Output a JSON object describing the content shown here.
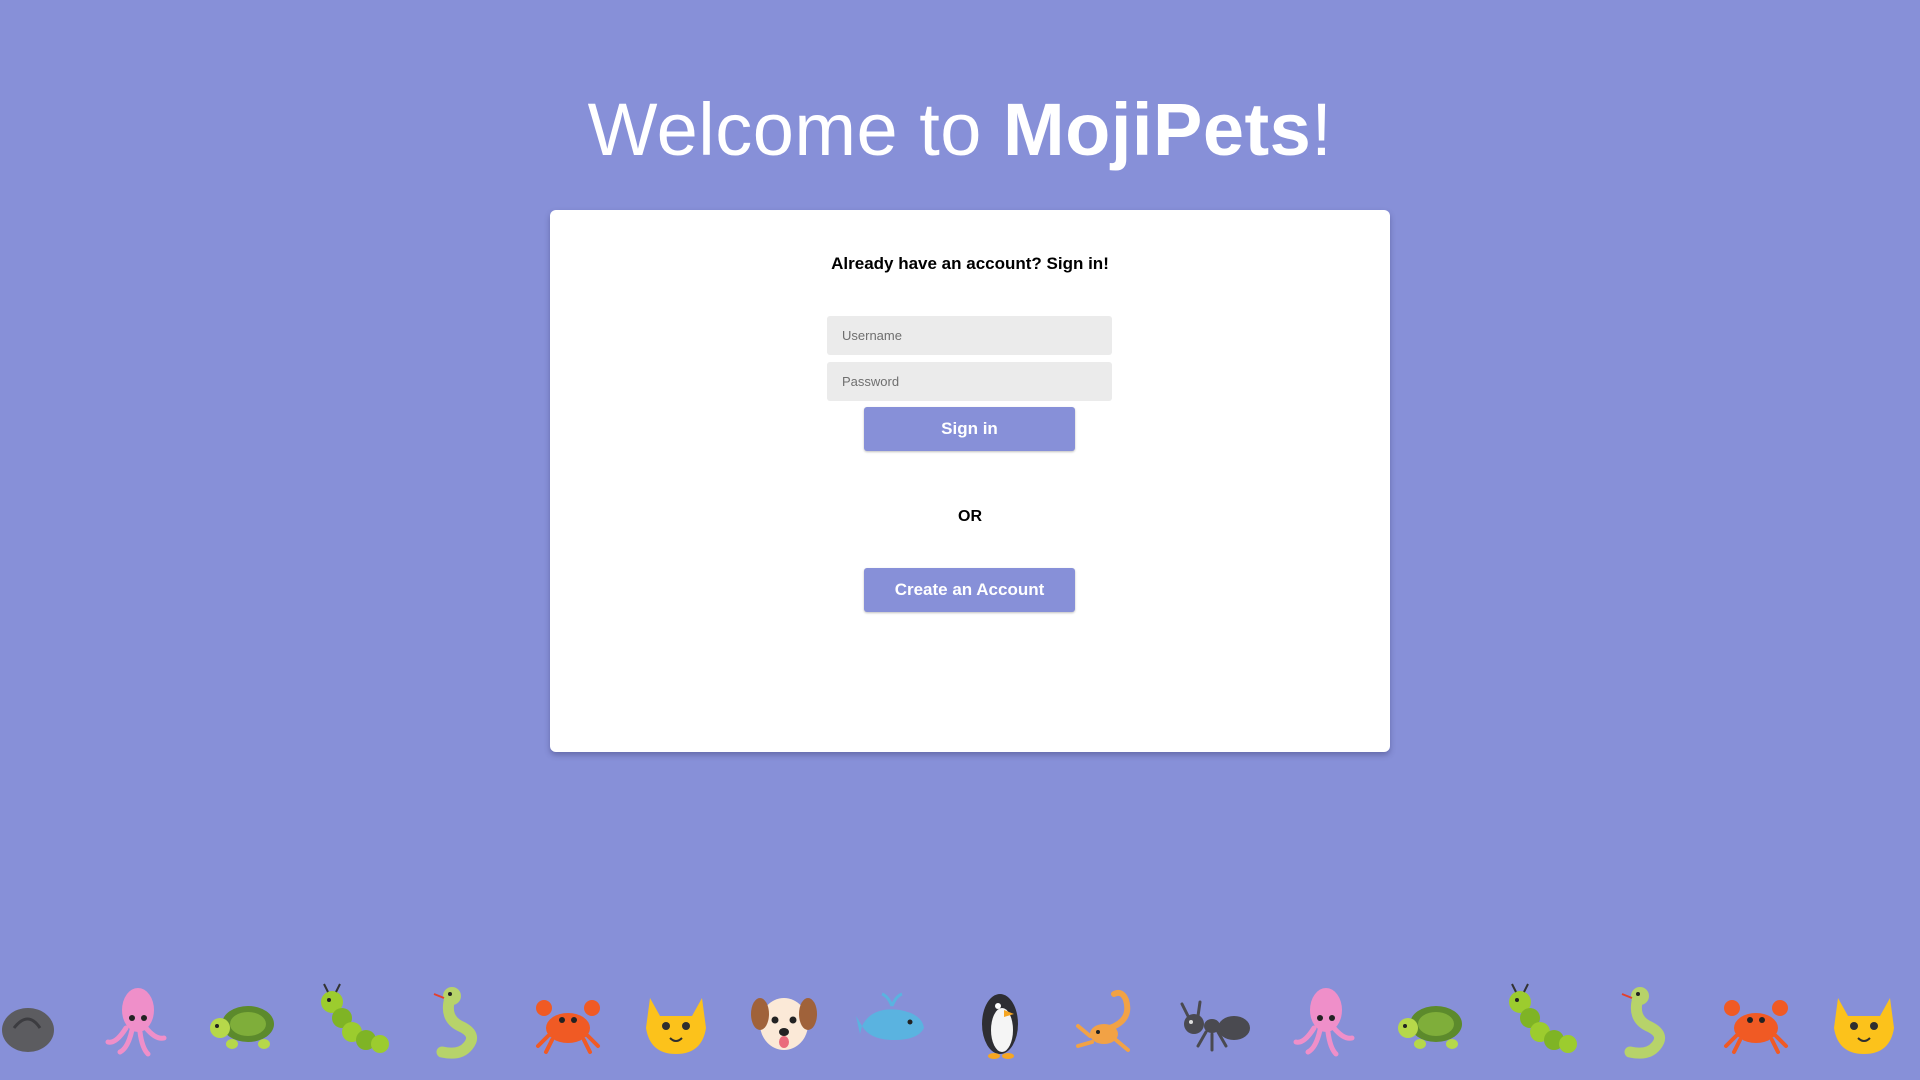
{
  "header": {
    "title_prefix": "Welcome to ",
    "brand": "MojiPets",
    "title_suffix": "!"
  },
  "signin": {
    "heading": "Already have an account? Sign in!",
    "username_placeholder": "Username",
    "username_value": "",
    "password_placeholder": "Password",
    "password_value": "",
    "signin_label": "Sign in"
  },
  "divider": {
    "label": "OR"
  },
  "signup": {
    "create_label": "Create an Account"
  },
  "colors": {
    "background": "#8790d8",
    "card": "#ffffff",
    "input_bg": "#ebebeb",
    "button": "#8790d8"
  },
  "pet_strip": {
    "icons": [
      "snail-shell-icon",
      "squid-icon",
      "turtle-icon",
      "caterpillar-icon",
      "snake-icon",
      "crab-icon",
      "cat-face-icon",
      "dog-face-icon",
      "whale-icon",
      "penguin-icon",
      "scorpion-icon",
      "ant-icon",
      "squid-icon",
      "turtle-icon",
      "caterpillar-icon",
      "snake-icon",
      "crab-icon",
      "cat-face-icon"
    ]
  }
}
